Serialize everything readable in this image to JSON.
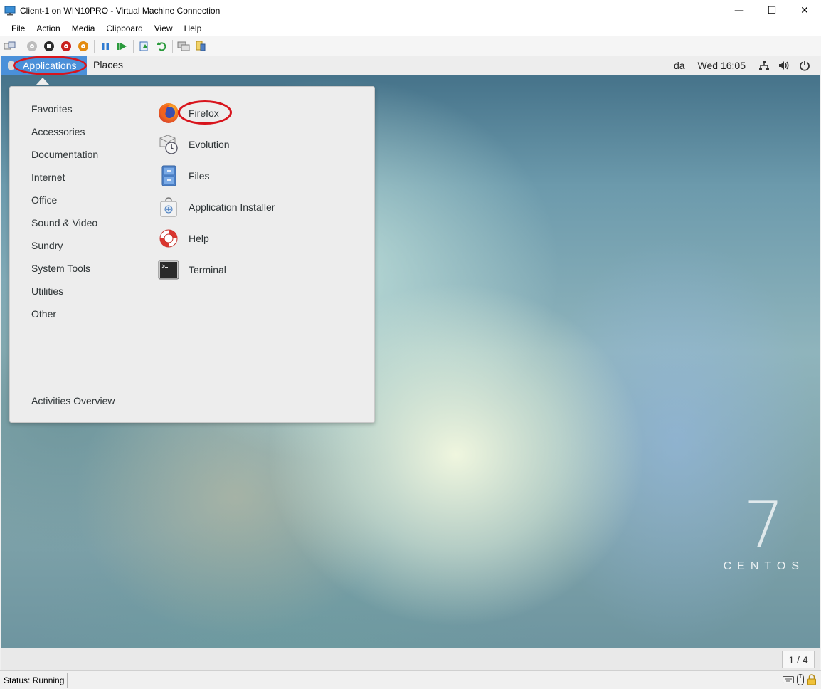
{
  "window": {
    "title": "Client-1 on WIN10PRO - Virtual Machine Connection",
    "minimize": "—",
    "maximize": "☐",
    "close": "✕"
  },
  "menubar": [
    "File",
    "Action",
    "Media",
    "Clipboard",
    "View",
    "Help"
  ],
  "toolbar": {
    "icons": [
      "ctrl-alt-del-icon",
      "start-icon",
      "turn-off-icon",
      "shut-down-icon",
      "save-icon",
      "pause-icon",
      "resume-icon",
      "checkpoint-icon",
      "revert-icon",
      "enhanced-session-icon",
      "share-icon"
    ]
  },
  "gnome": {
    "applications": "Applications",
    "places": "Places",
    "keyboard_layout": "da",
    "clock": "Wed 16:05"
  },
  "menu": {
    "categories": [
      "Favorites",
      "Accessories",
      "Documentation",
      "Internet",
      "Office",
      "Sound & Video",
      "Sundry",
      "System Tools",
      "Utilities",
      "Other"
    ],
    "activities": "Activities Overview",
    "apps": [
      {
        "name": "Firefox",
        "icon": "firefox-icon"
      },
      {
        "name": "Evolution",
        "icon": "evolution-icon"
      },
      {
        "name": "Files",
        "icon": "files-icon"
      },
      {
        "name": "Application Installer",
        "icon": "app-installer-icon"
      },
      {
        "name": "Help",
        "icon": "help-lifebuoy-icon"
      },
      {
        "name": "Terminal",
        "icon": "terminal-icon"
      }
    ]
  },
  "wallpaper": {
    "number": "7",
    "brand": "CENTOS"
  },
  "workspace": "1 / 4",
  "status": "Status: Running",
  "colors": {
    "highlight": "#4a90d9",
    "annotation": "#d8141c",
    "menu_bg": "#ededed"
  }
}
